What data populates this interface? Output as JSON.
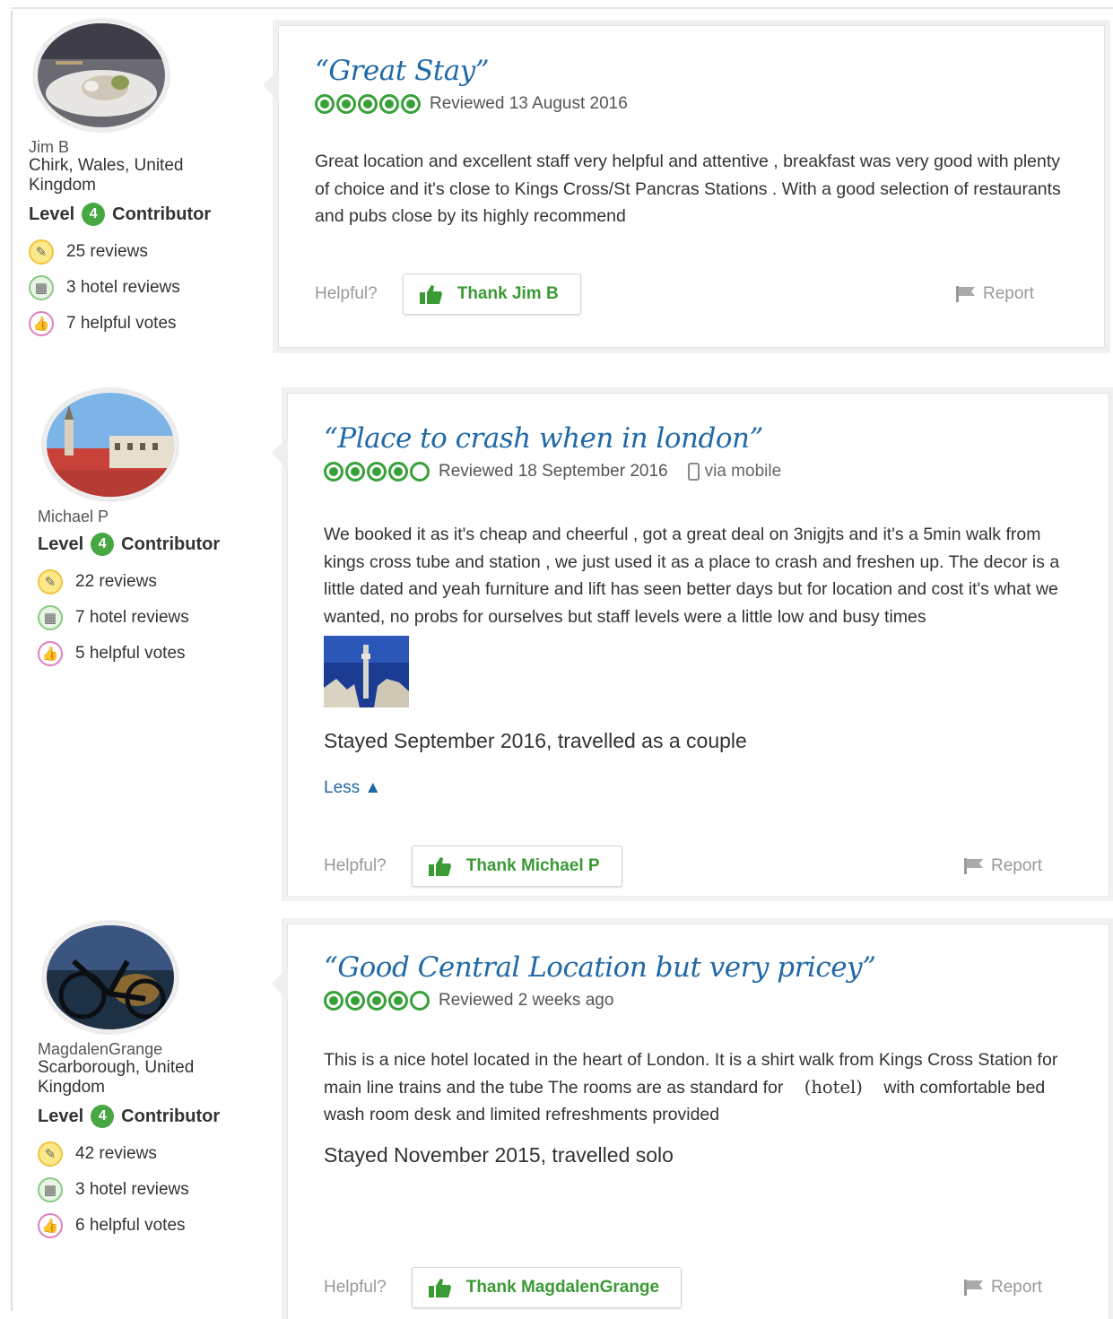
{
  "reviews": [
    {
      "profile": {
        "name": "Jim B",
        "location": "Chirk, Wales, United Kingdom",
        "level_label": "Level",
        "level": "4",
        "level_suffix": "Contributor",
        "reviews": "25 reviews",
        "hotel_reviews": "3 hotel reviews",
        "helpful_votes": "7 helpful votes"
      },
      "title": "“Great Stay”",
      "rating": 5,
      "reviewed": "Reviewed 13 August 2016",
      "body": "Great location and excellent staff very helpful and attentive , breakfast was very good with plenty of choice and it's close to Kings Cross/St Pancras Stations . With a good selection of restaurants and pubs close by its highly recommend",
      "helpful_label": "Helpful?",
      "thank_label": "Thank Jim B",
      "report_label": "Report"
    },
    {
      "profile": {
        "name": "Michael P",
        "level_label": "Level",
        "level": "4",
        "level_suffix": "Contributor",
        "reviews": "22 reviews",
        "hotel_reviews": "7 hotel reviews",
        "helpful_votes": "5 helpful votes"
      },
      "title": "“Place to crash when in london”",
      "rating": 4,
      "reviewed": "Reviewed 18 September 2016",
      "via": "via mobile",
      "body": "We booked it as it's cheap and cheerful , got a great deal on 3nigjts and it's a 5min walk from kings cross tube and station , we just used it as a place to crash and freshen up. The decor is a little dated and yeah furniture and lift has seen better days but for location and cost it's what we wanted, no probs for ourselves but staff levels were a little low and busy times",
      "stayed": "Stayed September 2016, travelled as a couple",
      "less_label": "Less ▲",
      "helpful_label": "Helpful?",
      "thank_label": "Thank Michael P",
      "report_label": "Report"
    },
    {
      "profile": {
        "name": "MagdalenGrange",
        "location": "Scarborough, United Kingdom",
        "level_label": "Level",
        "level": "4",
        "level_suffix": "Contributor",
        "reviews": "42 reviews",
        "hotel_reviews": "3 hotel reviews",
        "helpful_votes": "6 helpful votes"
      },
      "title": "“Good Central Location but very pricey”",
      "rating": 4,
      "reviewed": "Reviewed 2 weeks ago",
      "body_part1": "This is a nice hotel located in the heart of London. It is a shirt walk from Kings Cross Station for main line trains and the tube The rooms are as standard for",
      "body_hotel": "(hotel)",
      "body_part2": "with comfortable bed wash room desk and limited refreshments provided",
      "stayed": "Stayed November 2015, travelled solo",
      "helpful_label": "Helpful?",
      "thank_label": "Thank MagdalenGrange",
      "report_label": "Report"
    }
  ],
  "colors": {
    "link": "#2069a6",
    "green": "#36a137",
    "muted": "#999999"
  }
}
